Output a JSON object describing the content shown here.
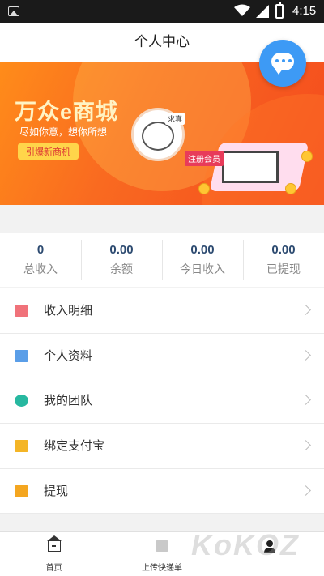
{
  "status_bar": {
    "time": "4:15",
    "icons": [
      "image-icon",
      "wifi-icon",
      "signal-icon",
      "battery-icon"
    ]
  },
  "header": {
    "title": "个人中心"
  },
  "banner": {
    "title": "万众e商城",
    "subtitle": "尽如你意，想你所想",
    "cta": "引爆新商机",
    "tag": "求真",
    "signup": "注册会员"
  },
  "chat_button": {
    "icon": "chat-bubble-icon"
  },
  "stats": [
    {
      "value": "0",
      "label": "总收入"
    },
    {
      "value": "0.00",
      "label": "余额"
    },
    {
      "value": "0.00",
      "label": "今日收入"
    },
    {
      "value": "0.00",
      "label": "已提现"
    }
  ],
  "menu": [
    {
      "label": "收入明细",
      "icon": "wallet-icon",
      "color": "#f0727a"
    },
    {
      "label": "个人资料",
      "icon": "id-card-icon",
      "color": "#5a9ee8"
    },
    {
      "label": "我的团队",
      "icon": "team-icon",
      "color": "#27b8a0"
    },
    {
      "label": "绑定支付宝",
      "icon": "card-icon",
      "color": "#f4b526"
    },
    {
      "label": "提现",
      "icon": "withdraw-icon",
      "color": "#f4a620"
    }
  ],
  "tabbar": [
    {
      "label": "首页",
      "icon": "home-icon"
    },
    {
      "label": "上传快递单",
      "icon": "upload-icon"
    },
    {
      "label": "",
      "icon": "user-icon"
    }
  ],
  "watermark": "KoKOZ",
  "colors": {
    "accent": "#3d9af5",
    "stat_value": "#2c4a70",
    "banner": "#f96a20"
  }
}
